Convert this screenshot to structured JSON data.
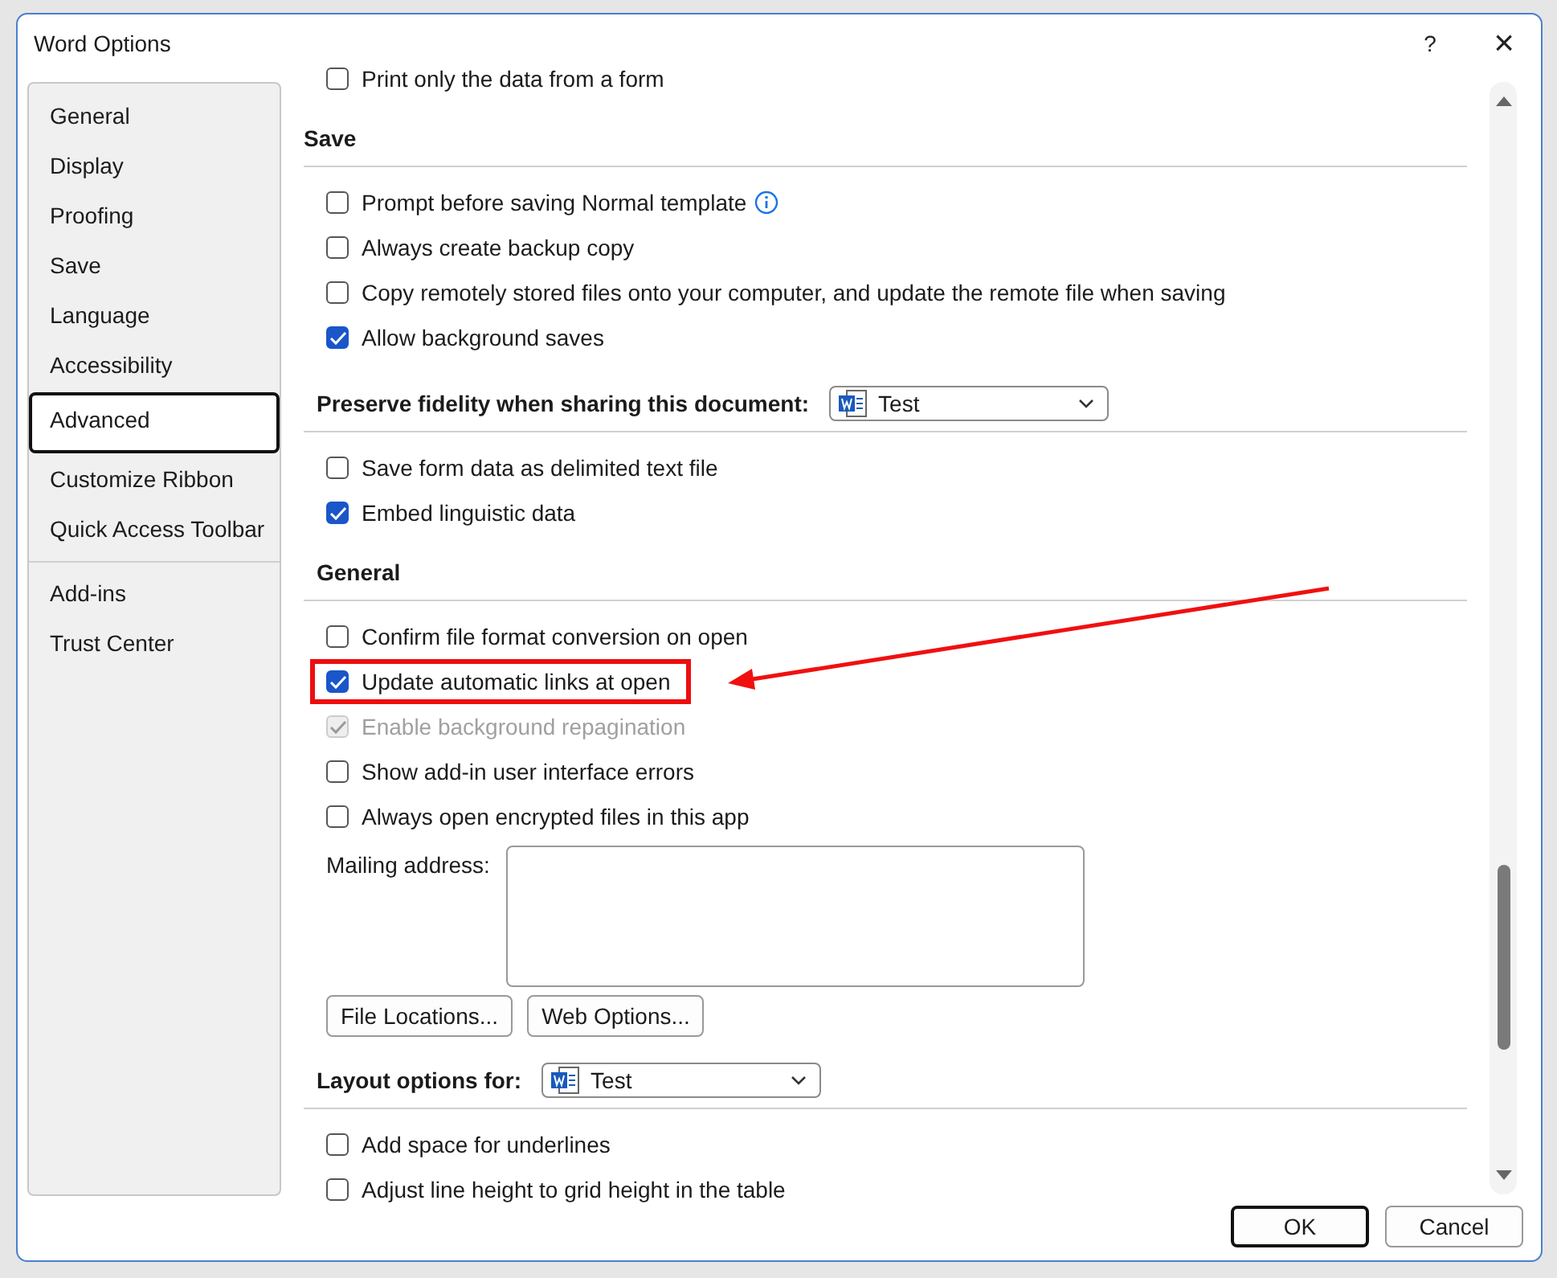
{
  "window": {
    "title": "Word Options",
    "help": "?",
    "close": "×"
  },
  "sidebar": {
    "items": [
      {
        "label": "General",
        "selected": false
      },
      {
        "label": "Display",
        "selected": false
      },
      {
        "label": "Proofing",
        "selected": false
      },
      {
        "label": "Save",
        "selected": false
      },
      {
        "label": "Language",
        "selected": false
      },
      {
        "label": "Accessibility",
        "selected": false
      },
      {
        "label": "Advanced",
        "selected": true
      },
      {
        "label": "Customize Ribbon",
        "selected": false
      },
      {
        "label": "Quick Access Toolbar",
        "selected": false,
        "divider_after": true
      },
      {
        "label": "Add-ins",
        "selected": false
      },
      {
        "label": "Trust Center",
        "selected": false
      }
    ]
  },
  "sections": [
    {
      "items": [
        {
          "kind": "checkbox",
          "label": "Print only the data from a form",
          "checked": false,
          "disabled": false
        }
      ]
    },
    {
      "heading": "Save",
      "items": [
        {
          "kind": "checkbox",
          "label": "Prompt before saving Normal template",
          "checked": false,
          "disabled": false,
          "info": true
        },
        {
          "kind": "checkbox",
          "label": "Always create backup copy",
          "checked": false,
          "disabled": false
        },
        {
          "kind": "checkbox",
          "label": "Copy remotely stored files onto your computer, and update the remote file when saving",
          "checked": false,
          "disabled": false
        },
        {
          "kind": "checkbox",
          "label": "Allow background saves",
          "checked": true,
          "disabled": false
        }
      ]
    },
    {
      "heading": "Preserve fidelity when sharing this document:",
      "dropdown": "Test",
      "items": [
        {
          "kind": "checkbox",
          "label": "Save form data as delimited text file",
          "checked": false,
          "disabled": false
        },
        {
          "kind": "checkbox",
          "label": "Embed linguistic data",
          "checked": true,
          "disabled": false
        }
      ]
    },
    {
      "heading": "General",
      "items": [
        {
          "kind": "checkbox",
          "label": "Confirm file format conversion on open",
          "checked": false,
          "disabled": false
        },
        {
          "kind": "checkbox",
          "label": "Update automatic links at open",
          "checked": true,
          "disabled": false,
          "highlighted": true
        },
        {
          "kind": "checkbox",
          "label": "Enable background repagination",
          "checked": true,
          "disabled": true
        },
        {
          "kind": "checkbox",
          "label": "Show add-in user interface errors",
          "checked": false,
          "disabled": false
        },
        {
          "kind": "checkbox",
          "label": "Always open encrypted files in this app",
          "checked": false,
          "disabled": false
        },
        {
          "kind": "textarea",
          "label": "Mailing address:"
        },
        {
          "kind": "buttons",
          "buttons": [
            "File Locations...",
            "Web Options..."
          ]
        }
      ]
    },
    {
      "heading": "Layout options for:",
      "dropdown": "Test",
      "items": [
        {
          "kind": "checkbox",
          "label": "Add space for underlines",
          "checked": false,
          "disabled": false
        },
        {
          "kind": "checkbox",
          "label": "Adjust line height to grid height in the table",
          "checked": false,
          "disabled": false
        }
      ]
    }
  ],
  "buttons": [
    "OK",
    "Cancel"
  ]
}
